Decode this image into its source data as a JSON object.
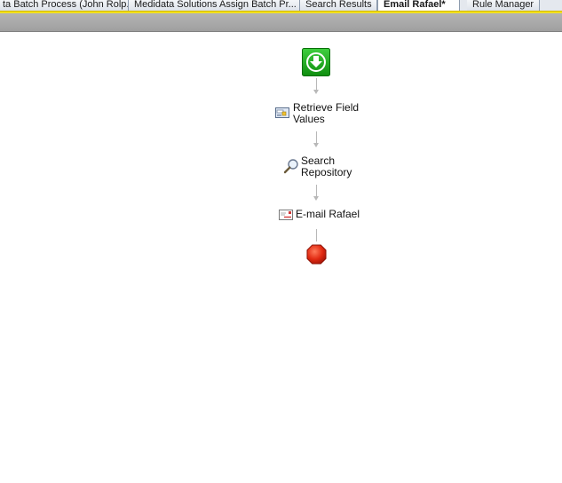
{
  "tabs": [
    {
      "label": "ta Batch Process (John Rolp...",
      "active": false
    },
    {
      "label": "Medidata Solutions Assign Batch Pr...",
      "active": false
    },
    {
      "label": "Search Results",
      "active": false
    },
    {
      "label": "Email Rafael*",
      "active": true
    },
    {
      "label": "Rule Manager",
      "active": false
    }
  ],
  "workflow": {
    "start_icon": "start-arrow-icon",
    "steps": [
      {
        "label_line1": "Retrieve Field",
        "label_line2": "Values",
        "icon": "retrieve-field-values-icon"
      },
      {
        "label_line1": "Search",
        "label_line2": "Repository",
        "icon": "magnifier-icon"
      },
      {
        "label_line1": "E-mail Rafael",
        "label_line2": "",
        "icon": "email-icon"
      }
    ],
    "end_icon": "stop-sign-icon"
  },
  "colors": {
    "accent_bar": "#f2e01e",
    "start_green": "#1aa81a",
    "stop_red": "#e12a12",
    "connector": "#b8b8b8"
  }
}
